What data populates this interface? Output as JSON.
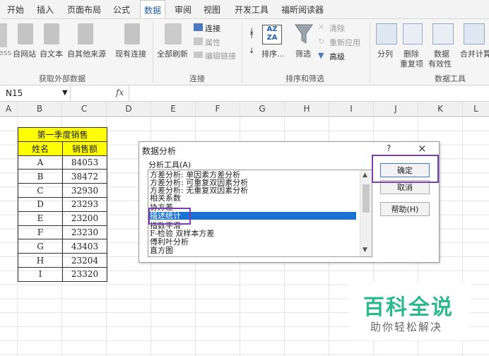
{
  "menu": [
    "开始",
    "插入",
    "页面布局",
    "公式",
    "数据",
    "审阅",
    "视图",
    "开发工具",
    "福昕阅读器"
  ],
  "ribbon": {
    "get_external": {
      "title": "获取外部数据",
      "buttons": [
        "自网站",
        "自文本",
        "自其他来源",
        "现有连接"
      ],
      "partial_left": "ess"
    },
    "connections": {
      "title": "连接",
      "refresh": "全部刷新",
      "items": [
        "连接",
        "属性",
        "编辑链接"
      ]
    },
    "sort_filter": {
      "title": "排序和筛选",
      "sort": "排序...",
      "filter": "筛选",
      "items": [
        "清除",
        "重新应用",
        "高级"
      ]
    },
    "data_tools": {
      "title": "数据工具",
      "split": "分列",
      "remove_dup": [
        "删除",
        "重复项"
      ],
      "validation": [
        "数据",
        "有效性"
      ],
      "consolidate": "合并计算"
    }
  },
  "formula_bar": {
    "namebox": "N15",
    "fx": "fx"
  },
  "columns": [
    "A",
    "B",
    "C",
    "D",
    "E",
    "F",
    "G",
    "H",
    "I",
    "J",
    "K",
    "L"
  ],
  "sheet_table": {
    "title": "第一季度销售",
    "headers": [
      "姓名",
      "销售额"
    ],
    "rows": [
      [
        "A",
        "84053"
      ],
      [
        "B",
        "38472"
      ],
      [
        "C",
        "32930"
      ],
      [
        "D",
        "23293"
      ],
      [
        "E",
        "23200"
      ],
      [
        "F",
        "23230"
      ],
      [
        "G",
        "43403"
      ],
      [
        "H",
        "23204"
      ],
      [
        "I",
        "23320"
      ]
    ]
  },
  "dialog": {
    "title": "数据分析",
    "help": "?",
    "close": "×",
    "label": "分析工具(A)",
    "items": [
      "方差分析: 单因素方差分析",
      "方差分析: 可重复双因素分析",
      "方差分析: 无重复双因素分析",
      "相关系数",
      "协方差",
      "描述统计",
      "指数平滑",
      "F-检验 双样本方差",
      "傅利叶分析",
      "直方图"
    ],
    "selected_index": 5,
    "ok": "确定",
    "cancel": "取消",
    "help_btn": "帮助(H)"
  },
  "watermark": {
    "title": "百科全说",
    "subtitle": "助你轻松解决"
  },
  "colors": {
    "accent": "#1a73d4",
    "highlight": "#7b3fb5",
    "yellow": "#ffff00",
    "watermark": "#2dba8a"
  }
}
